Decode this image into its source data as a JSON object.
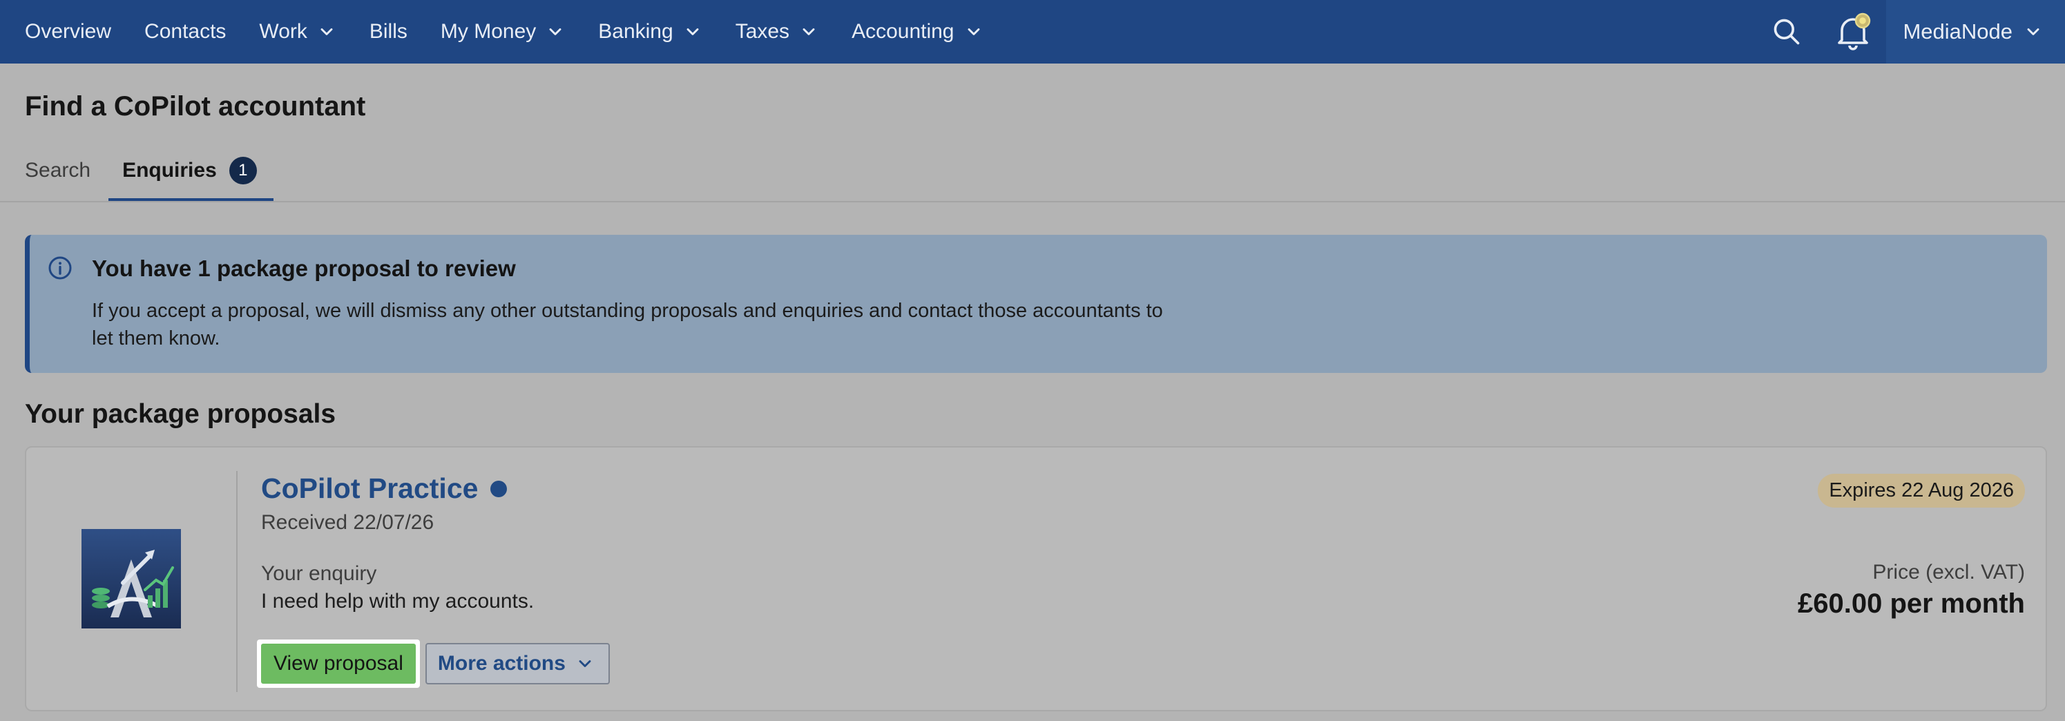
{
  "nav": {
    "items": [
      {
        "label": "Overview",
        "dropdown": false
      },
      {
        "label": "Contacts",
        "dropdown": false
      },
      {
        "label": "Work",
        "dropdown": true
      },
      {
        "label": "Bills",
        "dropdown": false
      },
      {
        "label": "My Money",
        "dropdown": true
      },
      {
        "label": "Banking",
        "dropdown": true
      },
      {
        "label": "Taxes",
        "dropdown": true
      },
      {
        "label": "Accounting",
        "dropdown": true
      }
    ],
    "org_name": "MediaNode",
    "search_icon": "search-icon",
    "notification_icon": "bell-icon"
  },
  "page": {
    "title": "Find a CoPilot accountant"
  },
  "tabs": {
    "search_label": "Search",
    "enquiries_label": "Enquiries",
    "enquiries_count": "1",
    "active": "Enquiries"
  },
  "banner": {
    "icon": "info-icon",
    "title": "You have 1 package proposal to review",
    "body": "If you accept a proposal, we will dismiss any other outstanding proposals and enquiries and contact those accountants to let them know."
  },
  "proposals": {
    "section_title": "Your package proposals",
    "items": [
      {
        "practice_name": "CoPilot Practice",
        "received": "Received 22/07/26",
        "enquiry_label": "Your enquiry",
        "enquiry_text": "I need help with my accounts.",
        "view_button": "View proposal",
        "more_actions": "More actions",
        "expiry": "Expires 22 Aug 2026",
        "price_label": "Price (excl. VAT)",
        "price_value": "£60.00 per month"
      }
    ]
  },
  "colors": {
    "nav_bg": "#1f4683",
    "banner_bg": "#8ba0b6",
    "primary_button": "#6dbb61",
    "link": "#214a84",
    "expiry_badge": "#c9b790"
  }
}
